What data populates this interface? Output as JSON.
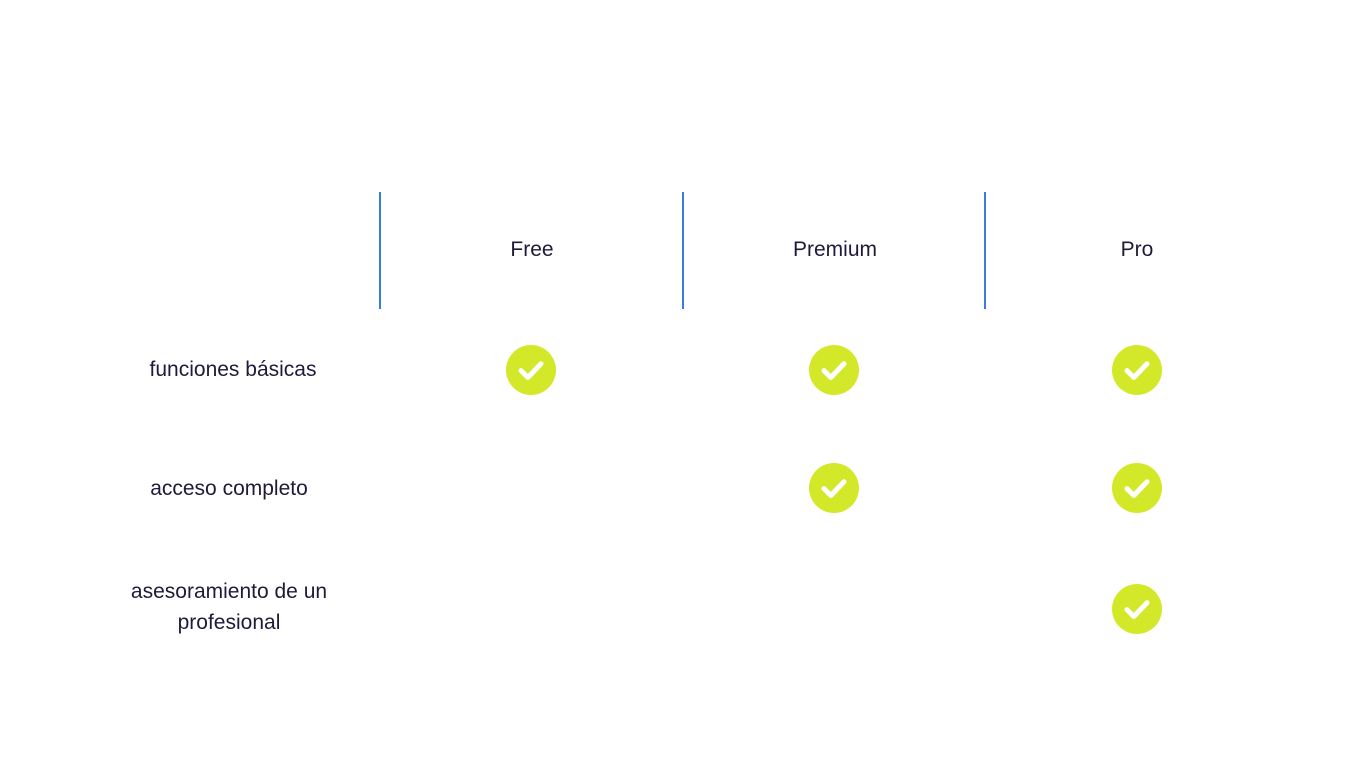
{
  "plans": [
    {
      "id": "free",
      "label": "Free"
    },
    {
      "id": "premium",
      "label": "Premium"
    },
    {
      "id": "pro",
      "label": "Pro"
    }
  ],
  "features": [
    {
      "label": "funciones básicas",
      "included": [
        true,
        true,
        true
      ]
    },
    {
      "label": "acceso completo",
      "included": [
        false,
        true,
        true
      ]
    },
    {
      "label": "asesoramiento de un profesional",
      "included": [
        false,
        false,
        true
      ]
    }
  ],
  "icons": {
    "check": "check-circle-icon"
  },
  "colors": {
    "divider": "#3b7dd8",
    "check_fill": "#d4e82a",
    "check_mark": "#ffffff",
    "text": "#1f1a3a"
  }
}
